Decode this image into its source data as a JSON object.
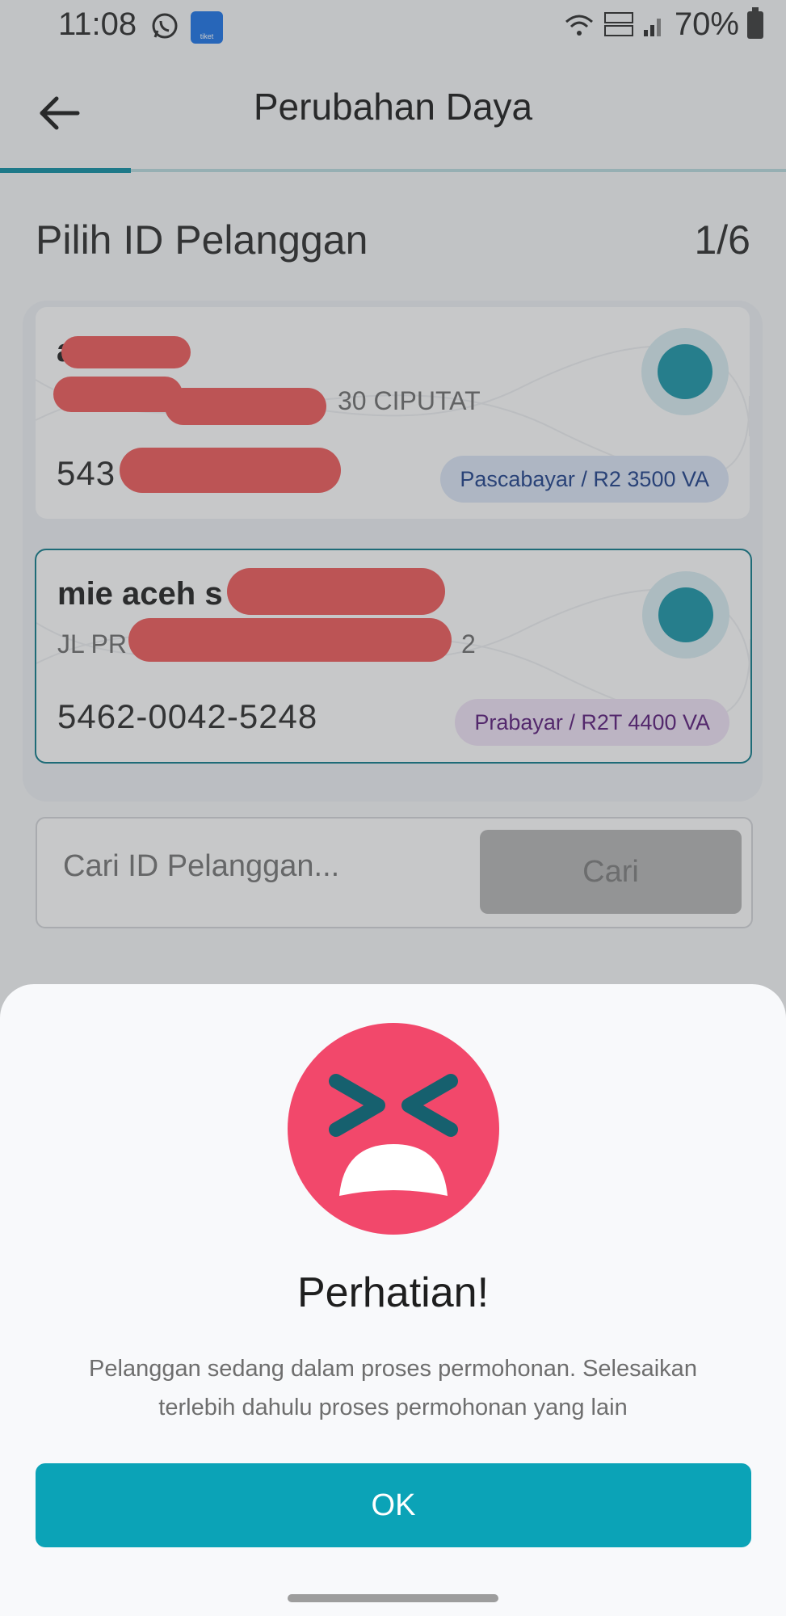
{
  "status_bar": {
    "time": "11:08",
    "battery_text": "70%",
    "notification_app_label": "tiket",
    "icons": [
      "whatsapp-icon",
      "tiket-app-icon",
      "wifi-icon",
      "volte-lte-icon",
      "signal-icon",
      "battery-icon"
    ]
  },
  "app_bar": {
    "title": "Perubahan Daya",
    "back_icon": "arrow-left-icon",
    "progress_fraction": 0.1667
  },
  "section": {
    "title": "Pilih ID Pelanggan",
    "step": "1/6"
  },
  "customers": [
    {
      "name": "a",
      "address": "30 CIPUTAT",
      "id_number": "543",
      "plan": "Pascabayar / R2 3500 VA",
      "selected": false
    },
    {
      "name": "mie aceh s",
      "address_left": "JL PR",
      "address_right": "2",
      "id_number": "5462-0042-5248",
      "plan": "Prabayar / R2T 4400 VA",
      "selected": true
    }
  ],
  "search": {
    "placeholder": "Cari ID Pelanggan...",
    "button_label": "Cari"
  },
  "dialog": {
    "icon": "sad-face-icon",
    "title": "Perhatian!",
    "message": "Pelanggan sedang dalam proses permohonan. Selesaikan terlebih dahulu proses permohonan yang lain",
    "ok_label": "OK"
  },
  "colors": {
    "primary": "#0ba3b7",
    "accent_dark": "#0e7a8a",
    "sad_face": "#f2486b",
    "redaction": "#f05a5a"
  }
}
